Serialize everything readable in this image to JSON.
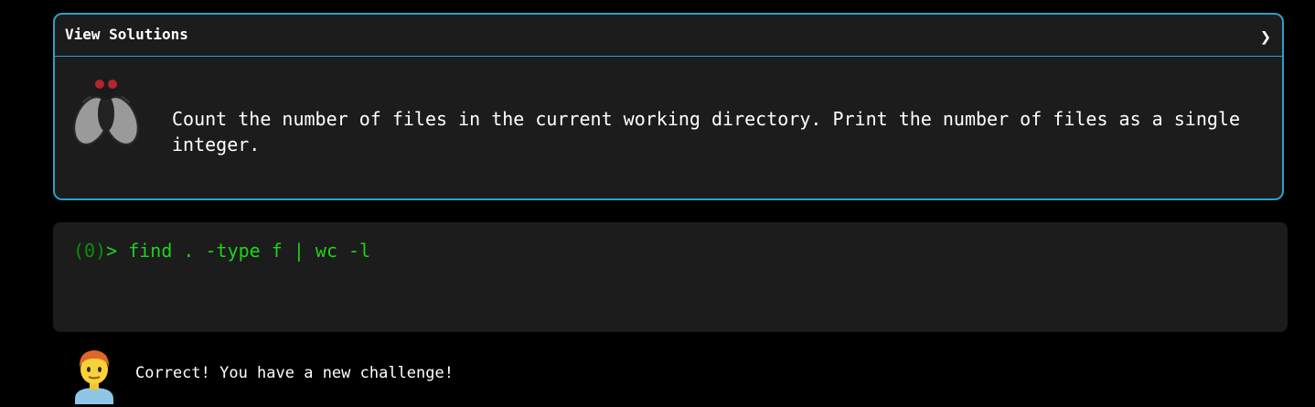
{
  "challenge": {
    "header_title": "View Solutions",
    "chevron_icon": "chevron-right-icon",
    "chevron_glyph": "❯",
    "mascot_icon": "fly-icon",
    "prompt": "Count the number of files in the current working directory. Print the number of files as a single integer.",
    "border_color": "#2aa0c8"
  },
  "terminal": {
    "counter": "(0)",
    "prompt_symbol": ">",
    "command": " find . -type f | wc -l",
    "text_color": "#1fd21f"
  },
  "feedback": {
    "avatar_icon": "man-avatar-icon",
    "message": "Correct! You have a new challenge!"
  }
}
